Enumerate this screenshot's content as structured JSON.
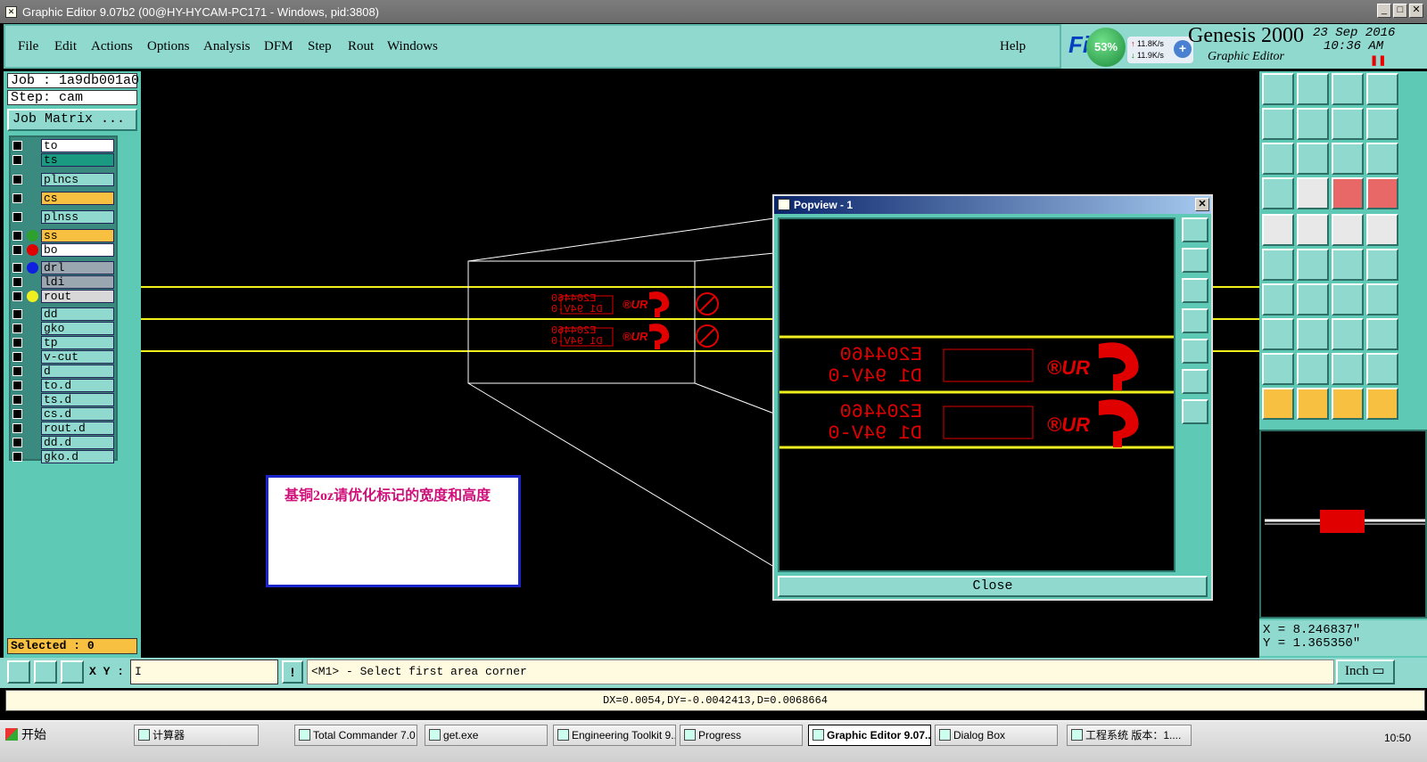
{
  "window": {
    "title": "Graphic Editor 9.07b2 (00@HY-HYCAM-PC171 - Windows, pid:3808)"
  },
  "menu": {
    "file": "File",
    "edit": "Edit",
    "actions": "Actions",
    "options": "Options",
    "analysis": "Analysis",
    "dfm": "DFM",
    "step": "Step",
    "rout": "Rout",
    "windows": "Windows",
    "help": "Help"
  },
  "brand": {
    "logo_text": "Fi",
    "gauge": "53%",
    "net_up": "11.8K/s",
    "net_down": "11.9K/s",
    "product": "Genesis 2000",
    "subtitle": "Graphic Editor",
    "date": "23 Sep 2016",
    "time": "10:36 AM"
  },
  "job": {
    "job_label": "Job : 1a9db001a0",
    "step_label": "Step: cam",
    "matrix_button": "Job Matrix ..."
  },
  "layers": [
    {
      "name": "to",
      "bg": "#ffffff",
      "dot": ""
    },
    {
      "name": "ts",
      "bg": "#1a9a80",
      "dot": ""
    },
    {
      "name": "plncs",
      "bg": "#8fd9cf",
      "dot": ""
    },
    {
      "name": "cs",
      "bg": "#f8c040",
      "dot": ""
    },
    {
      "name": "plnss",
      "bg": "#8fd9cf",
      "dot": ""
    },
    {
      "name": "ss",
      "bg": "#f8c040",
      "dot": "#2ea02e"
    },
    {
      "name": "bo",
      "bg": "#ffffff",
      "dot": "#e00000"
    },
    {
      "name": "drl",
      "bg": "#9aa6b0",
      "dot": "#1020e0"
    },
    {
      "name": "ldi",
      "bg": "#9aa6b0",
      "dot": ""
    },
    {
      "name": "rout",
      "bg": "#d8d8d8",
      "dot": "#f0f020"
    },
    {
      "name": "dd",
      "bg": "#8fd9cf",
      "dot": ""
    },
    {
      "name": "gko",
      "bg": "#8fd9cf",
      "dot": ""
    },
    {
      "name": "tp",
      "bg": "#8fd9cf",
      "dot": ""
    },
    {
      "name": "v-cut",
      "bg": "#8fd9cf",
      "dot": ""
    },
    {
      "name": "d",
      "bg": "#8fd9cf",
      "dot": ""
    },
    {
      "name": "to.d",
      "bg": "#8fd9cf",
      "dot": ""
    },
    {
      "name": "ts.d",
      "bg": "#8fd9cf",
      "dot": ""
    },
    {
      "name": "cs.d",
      "bg": "#8fd9cf",
      "dot": ""
    },
    {
      "name": "rout.d",
      "bg": "#8fd9cf",
      "dot": ""
    },
    {
      "name": "dd.d",
      "bg": "#8fd9cf",
      "dot": ""
    },
    {
      "name": "gko.d",
      "bg": "#8fd9cf",
      "dot": ""
    }
  ],
  "selected": "Selected : 0",
  "canvas": {
    "mark_line1": "E204460",
    "mark_line2": "D1 94V-0"
  },
  "note": {
    "text": "基铜2oz请优化标记的宽度和高度"
  },
  "popview": {
    "title": "Popview - 1",
    "close_label": "Close",
    "mark_line1": "E204460",
    "mark_line2": "D1 94V-0"
  },
  "coords": {
    "x": "X = 8.246837\"",
    "y": "Y = 1.365350\""
  },
  "bottom": {
    "xy_label": "X Y :",
    "xy_value": "I",
    "prompt": "<M1> - Select first area corner",
    "unit": "Inch"
  },
  "status": "DX=0.0054,DY=-0.0042413,D=0.0068664",
  "taskbar": {
    "start": "开始",
    "items": [
      "计算器",
      "Total Commander 7.0 ...",
      "get.exe",
      "Engineering Toolkit 9....",
      "Progress",
      "Graphic Editor 9.07...",
      "Dialog Box",
      "工程系统  版本：1...."
    ],
    "clock": "10:50"
  },
  "colors": {
    "panel": "#5ec9b5",
    "button": "#8fd9cf",
    "yellow_line": "#f0f020",
    "mark_red": "#e00000"
  }
}
